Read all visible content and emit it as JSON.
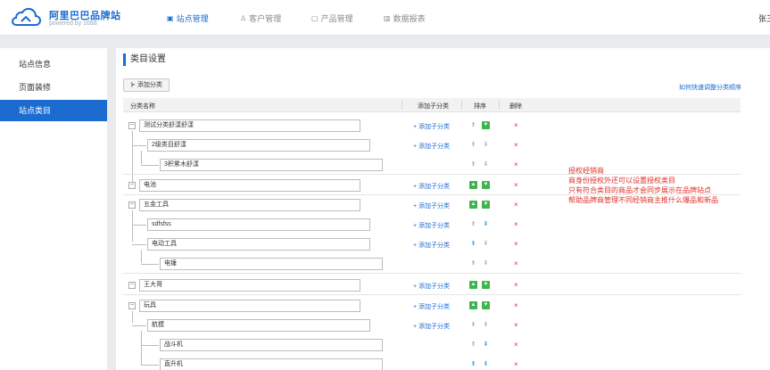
{
  "header": {
    "brand_title": "阿里巴巴品牌站",
    "brand_sub": "powered by 1688",
    "nav": [
      {
        "label": "站点管理",
        "icon": "monitor-icon"
      },
      {
        "label": "客户管理",
        "icon": "user-icon"
      },
      {
        "label": "产品管理",
        "icon": "box-icon"
      },
      {
        "label": "数据报表",
        "icon": "bar-chart-icon"
      }
    ],
    "user": "张三"
  },
  "sidebar": {
    "items": [
      {
        "label": "站点信息"
      },
      {
        "label": "页面装修"
      },
      {
        "label": "站点类目"
      }
    ]
  },
  "main": {
    "title": "类目设置",
    "add_button": "添加分类",
    "help_link": "如何快速调整分类顺序",
    "table": {
      "col_name": "分类名称",
      "col_add": "添加子分类",
      "col_sort": "排序",
      "col_delete": "删除"
    },
    "add_sub_label": "+ 添加子分类",
    "delete_symbol": "×",
    "rows": [
      {
        "name": "测试分类舒漾舒漾"
      },
      {
        "name": "2级类目舒漾"
      },
      {
        "name": "3积累木舒漾"
      },
      {
        "name": "电池"
      },
      {
        "name": "五金工具"
      },
      {
        "name": "sdfsfss"
      },
      {
        "name": "电动工具"
      },
      {
        "name": "电锤"
      },
      {
        "name": "王大哥"
      },
      {
        "name": "玩具"
      },
      {
        "name": "航模"
      },
      {
        "name": "战斗机"
      },
      {
        "name": "直升机"
      }
    ]
  },
  "note": {
    "lines": [
      "授权经销商",
      "商身份授权外还可以设置授权类目",
      "只有符合类目的商品才会同步展示在品牌站点",
      "帮助品牌商管理不同经销商主推什么爆品和新品"
    ]
  },
  "colors": {
    "accent": "#1b6bd1",
    "alert": "#e0302a",
    "sort_active": "#3fb34f"
  }
}
